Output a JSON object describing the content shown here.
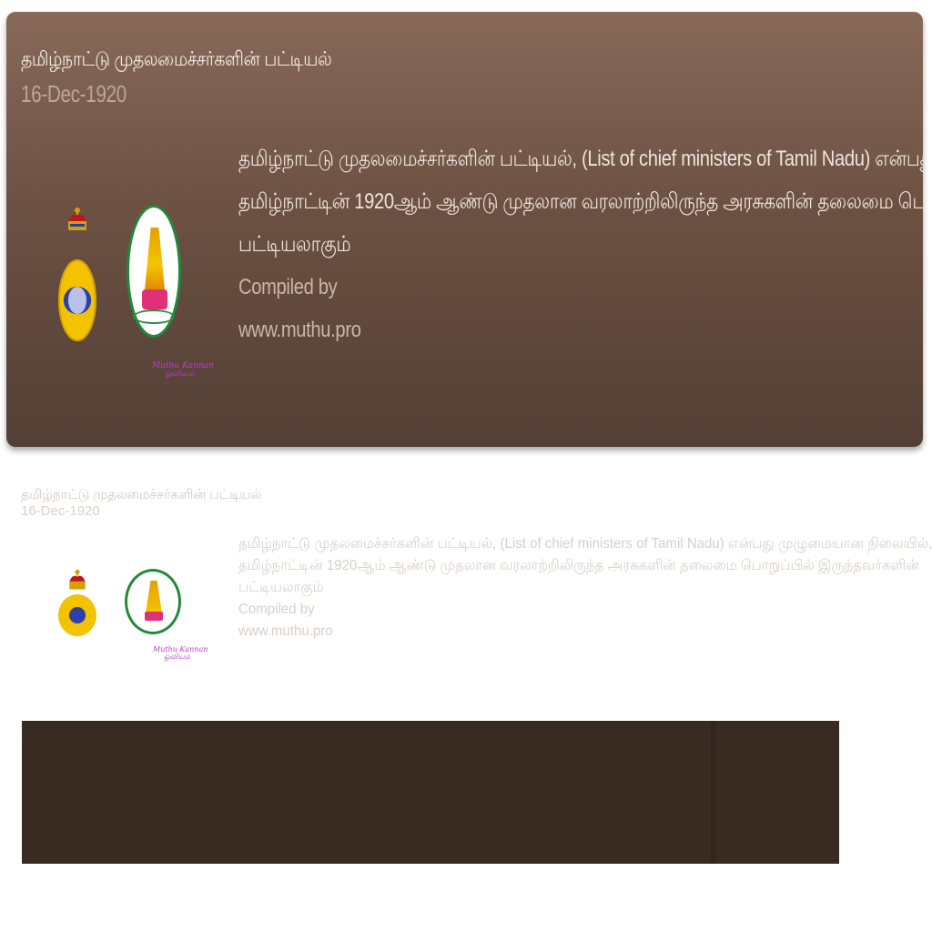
{
  "hero": {
    "title": "தமிழ்நாட்டு முதலமைச்சர்களின் பட்டியல்",
    "date": "16-Dec-1920",
    "description_lines": [
      "தமிழ்நாட்டு முதலமைச்சர்களின் பட்டியல், (List of chief ministers of Tamil Nadu) என்பது முழுமையான நிலையில்,",
      "தமிழ்நாட்டின் 1920ஆம் ஆண்டு முதலான வரலாற்றிலிருந்த அரசுகளின் தலைமை பொறுப்பில் இருந்தவர்களின்",
      "பட்டியலாகும்"
    ],
    "compiled_by": "Compiled by",
    "website": "www.muthu.pro",
    "signature_line1": "Muthu Kannan",
    "signature_line2": "ஓவியம்"
  },
  "ghost": {
    "title": "தமிழ்நாட்டு முதலமைச்சர்களின் பட்டியல்",
    "date": "16-Dec-1920",
    "description_lines": [
      "தமிழ்நாட்டு முதலமைச்சர்களின் பட்டியல், (List of chief ministers of Tamil Nadu) என்பது முழுமையான நிலையில்,",
      "தமிழ்நாட்டின் 1920ஆம் ஆண்டு முதலான வரலாற்றிலிருந்த அரசுகளின் தலைமை பொறுப்பில் இருந்தவர்களின்",
      "பட்டியலாகும்"
    ],
    "compiled_by": "Compiled by",
    "website": "www.muthu.pro",
    "signature_line1": "Muthu Kannan",
    "signature_line2": "ஓவியம்"
  },
  "colors": {
    "card_top": "#88695a",
    "card_bottom": "#523f35",
    "dark_panel": "#392a22",
    "seal_green": "#1f8a3a",
    "seal_gold": "#f6c400",
    "medal_blue": "#2d3fa8",
    "signature_magenta": "#c13bcf"
  },
  "icons": {
    "crown": "imperial-crown-icon",
    "medal": "star-of-india-medal-icon",
    "seal": "tamil-nadu-emblem-icon"
  }
}
